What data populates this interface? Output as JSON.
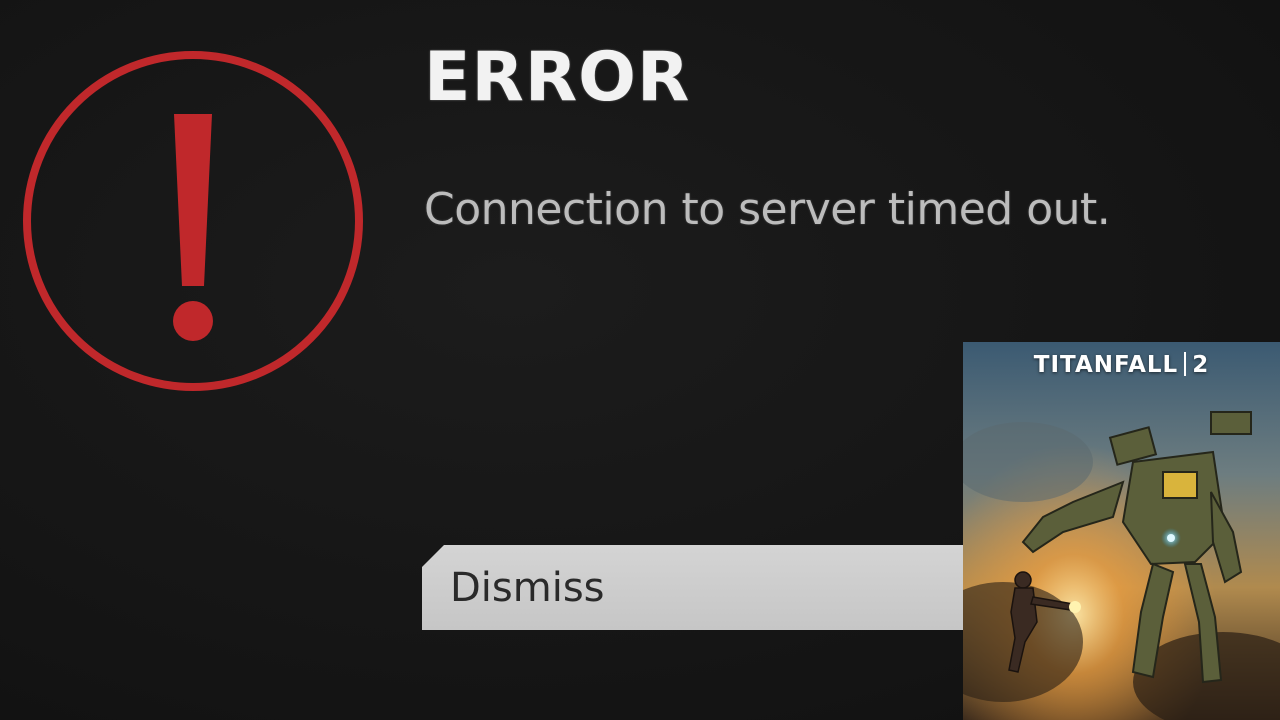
{
  "dialog": {
    "title": "ERROR",
    "message": "Connection to server timed out.",
    "dismiss_label": "Dismiss"
  },
  "cover": {
    "title": "TITANFALL",
    "number": "2"
  },
  "colors": {
    "background": "#161616",
    "icon_red": "#c0282b",
    "title_text": "#f2f2f2",
    "message_text": "#bcbcbc",
    "button_bg": "#cfcfcf",
    "button_text": "#2a2a2a"
  },
  "icons": {
    "error": "exclamation-circle-icon"
  }
}
